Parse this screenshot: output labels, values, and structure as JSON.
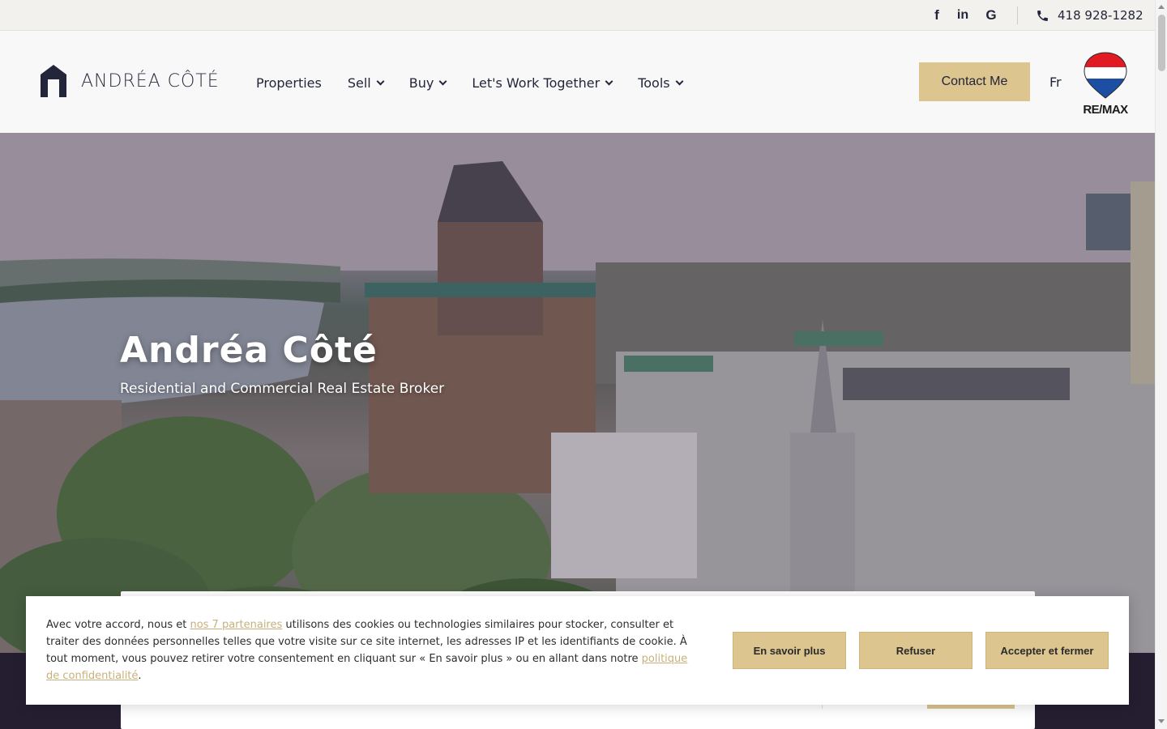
{
  "topbar": {
    "socials": [
      {
        "name": "facebook",
        "glyph": "f"
      },
      {
        "name": "linkedin",
        "glyph": "in"
      },
      {
        "name": "google",
        "glyph": "G"
      }
    ],
    "phone": "418 928-1282"
  },
  "header": {
    "logo_text": "ANDRÉA CÔTÉ",
    "nav": [
      {
        "label": "Properties",
        "dropdown": false
      },
      {
        "label": "Sell",
        "dropdown": true
      },
      {
        "label": "Buy",
        "dropdown": true
      },
      {
        "label": "Let's Work Together",
        "dropdown": true
      },
      {
        "label": "Tools",
        "dropdown": true
      }
    ],
    "contact_label": "Contact Me",
    "lang_label": "Fr",
    "remax_label": "RE/MAX"
  },
  "hero": {
    "title": "Andréa Côté",
    "subtitle": "Residential and Commercial Real Estate Broker"
  },
  "cookie": {
    "text_before_link": "Avec votre accord, nous et ",
    "partners_link": "nos 7 partenaires",
    "text_middle": " utilisons des cookies ou technologies similaires pour stocker, consulter et traiter des données personnelles telles que votre visite sur ce site internet, les adresses IP et les identifiants de cookie. À tout moment, vous pouvez retirer votre consentement en cliquant sur « En savoir plus » ou en allant dans notre ",
    "privacy_link": "politique de confidentialité",
    "text_after": ".",
    "learn_more": "En savoir plus",
    "refuse": "Refuser",
    "accept": "Accepter et fermer"
  },
  "colors": {
    "accent_gold": "#dcc58f",
    "dark_navy": "#23263a",
    "band_dark": "#251e31"
  }
}
